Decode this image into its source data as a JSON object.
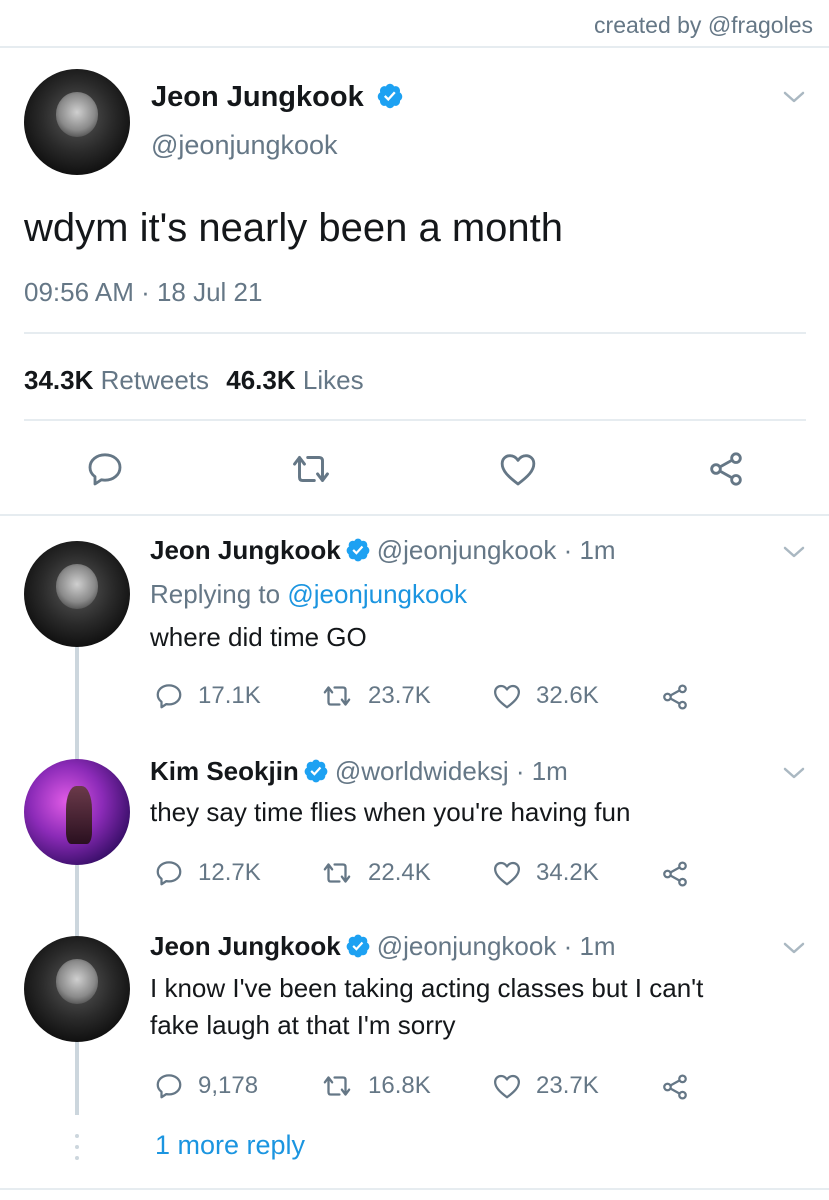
{
  "watermark": "created by @fragoles",
  "main_tweet": {
    "name": "Jeon Jungkook",
    "handle": "@jeonjungkook",
    "text": "wdym it's nearly been a month",
    "timestamp": "09:56 AM · 18 Jul 21",
    "retweets_count": "34.3K",
    "retweets_label": "Retweets",
    "likes_count": "46.3K",
    "likes_label": "Likes"
  },
  "replies": [
    {
      "name": "Jeon Jungkook",
      "handle": "@jeonjungkook",
      "time": "· 1m",
      "replying_prefix": "Replying to",
      "replying_to": "@jeonjungkook",
      "text": "where did time GO",
      "replies": "17.1K",
      "retweets": "23.7K",
      "likes": "32.6K"
    },
    {
      "name": "Kim Seokjin",
      "handle": "@worldwideksj",
      "time": "· 1m",
      "text": "they say time flies when you're having fun",
      "replies": "12.7K",
      "retweets": "22.4K",
      "likes": "34.2K"
    },
    {
      "name": "Jeon Jungkook",
      "handle": "@jeonjungkook",
      "time": "· 1m",
      "text_line1": "I know I've been taking acting classes but I can't",
      "text_line2": "fake laugh at that I'm sorry",
      "replies": "9,178",
      "retweets": "16.8K",
      "likes": "23.7K"
    }
  ],
  "more_replies": "1 more reply",
  "colors": {
    "link": "#1b95e0",
    "secondary": "#657786",
    "divider": "#e6ecf0",
    "verified": "#1da1f2"
  }
}
